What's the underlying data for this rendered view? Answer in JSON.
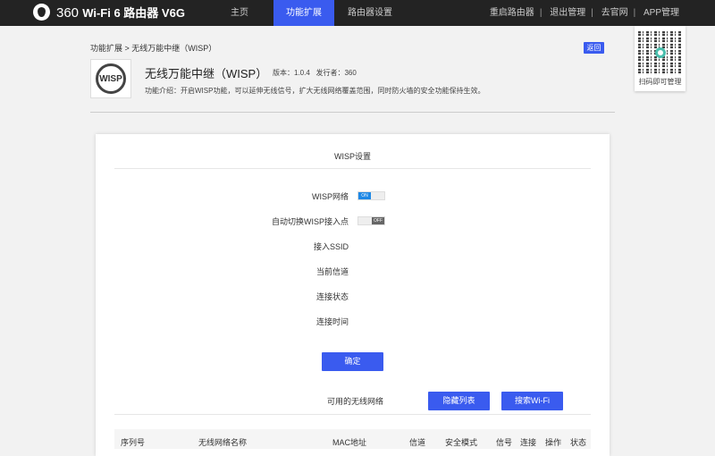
{
  "header": {
    "brand": "360",
    "product": "Wi-Fi 6 路由器 V6G",
    "nav": [
      {
        "label": "主页"
      },
      {
        "label": "功能扩展",
        "active": true
      },
      {
        "label": "路由器设置"
      }
    ],
    "links": [
      "重启路由器",
      "退出管理",
      "去官网",
      "APP管理"
    ]
  },
  "qr": {
    "label": "扫码即可管理"
  },
  "breadcrumb": "功能扩展 > 无线万能中继（WISP）",
  "back_label": "返回",
  "app": {
    "icon_text": "WISP",
    "title": "无线万能中继（WISP）",
    "version": "版本：1.0.4",
    "publisher": "发行者：360",
    "description": "功能介绍：开启WISP功能，可以延伸无线信号，扩大无线网络覆盖范围，同时防火墙的安全功能保持生效。"
  },
  "wisp": {
    "title": "WISP设置",
    "fields": [
      {
        "label": "WISP网络",
        "toggle": "ON"
      },
      {
        "label": "自动切换WISP接入点",
        "toggle": "OFF"
      },
      {
        "label": "接入SSID"
      },
      {
        "label": "当前信道"
      },
      {
        "label": "连接状态"
      },
      {
        "label": "连接时间"
      }
    ],
    "confirm": "确定",
    "available_label": "可用的无线网络",
    "hide_list": "隐藏列表",
    "search_wifi": "搜索Wi-Fi",
    "columns": [
      "序列号",
      "无线网络名称",
      "MAC地址",
      "信道",
      "安全模式",
      "信号",
      "连接",
      "操作",
      "状态"
    ]
  },
  "colors": {
    "accent": "#3a5bef",
    "topbar": "#232323"
  }
}
